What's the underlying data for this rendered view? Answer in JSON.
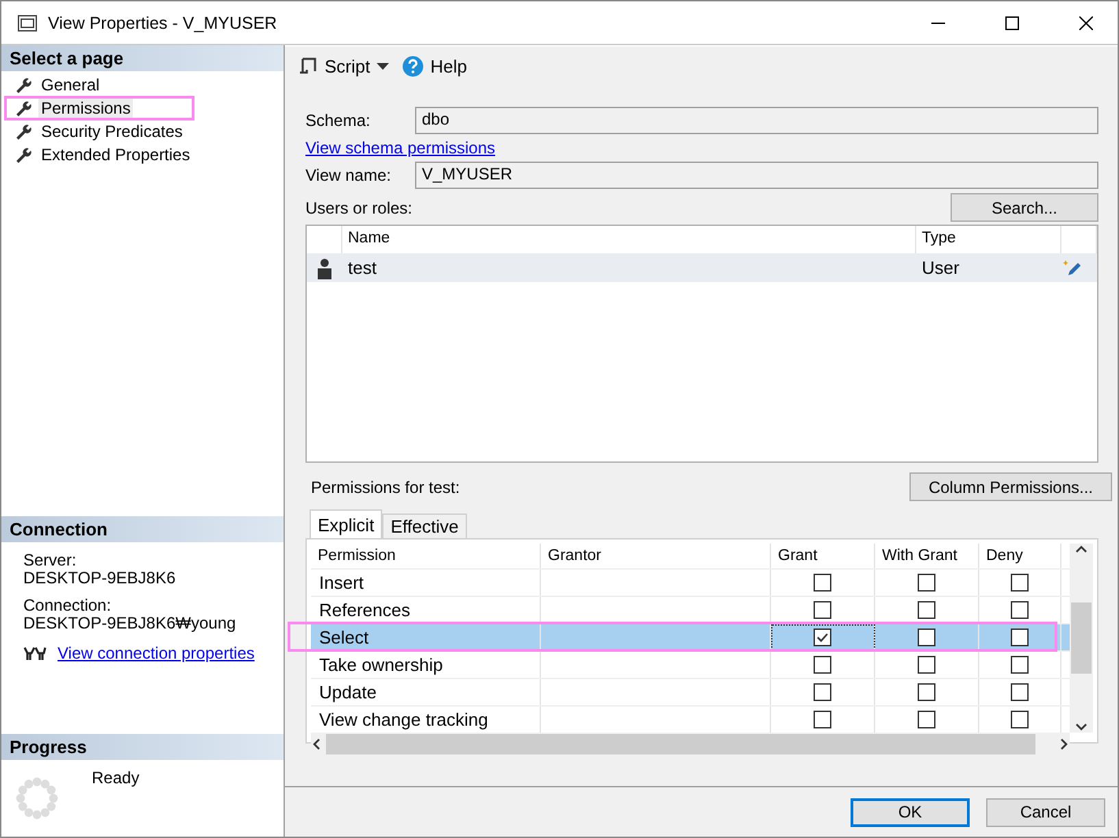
{
  "window": {
    "title": "View Properties - V_MYUSER"
  },
  "sidebar": {
    "heading": "Select a page",
    "items": [
      {
        "label": "General",
        "selected": false,
        "highlighted": false
      },
      {
        "label": "Permissions",
        "selected": true,
        "highlighted": true
      },
      {
        "label": "Security Predicates",
        "selected": false,
        "highlighted": false
      },
      {
        "label": "Extended Properties",
        "selected": false,
        "highlighted": false
      }
    ]
  },
  "connection": {
    "heading": "Connection",
    "server_label": "Server:",
    "server": "DESKTOP-9EBJ8K6",
    "connection_label": "Connection:",
    "connection": "DESKTOP-9EBJ8K6₩young",
    "link": "View connection properties"
  },
  "progress": {
    "heading": "Progress",
    "status": "Ready"
  },
  "toolbar": {
    "script": "Script",
    "help": "Help"
  },
  "schema": {
    "label": "Schema:",
    "value": "dbo",
    "link": "View schema permissions"
  },
  "view_name": {
    "label": "View name:",
    "value": "V_MYUSER"
  },
  "users": {
    "label": "Users or roles:",
    "search_button": "Search...",
    "columns": [
      "Name",
      "Type"
    ],
    "rows": [
      {
        "name": "test",
        "type": "User",
        "selected": true
      }
    ]
  },
  "permissions": {
    "label": "Permissions for test:",
    "column_button": "Column Permissions...",
    "tabs": [
      {
        "label": "Explicit",
        "selected": true
      },
      {
        "label": "Effective",
        "selected": false
      }
    ],
    "columns": [
      "Permission",
      "Grantor",
      "Grant",
      "With Grant",
      "Deny"
    ],
    "rows": [
      {
        "permission": "Insert",
        "grant": false,
        "with_grant": false,
        "deny": false,
        "selected": false,
        "highlighted": false
      },
      {
        "permission": "References",
        "grant": false,
        "with_grant": false,
        "deny": false,
        "selected": false,
        "highlighted": false
      },
      {
        "permission": "Select",
        "grant": true,
        "with_grant": false,
        "deny": false,
        "selected": true,
        "highlighted": true
      },
      {
        "permission": "Take ownership",
        "grant": false,
        "with_grant": false,
        "deny": false,
        "selected": false,
        "highlighted": false
      },
      {
        "permission": "Update",
        "grant": false,
        "with_grant": false,
        "deny": false,
        "selected": false,
        "highlighted": false
      },
      {
        "permission": "View change tracking",
        "grant": false,
        "with_grant": false,
        "deny": false,
        "selected": false,
        "highlighted": false
      }
    ]
  },
  "buttons": [
    {
      "label": "OK",
      "default": true
    },
    {
      "label": "Cancel",
      "default": false
    }
  ]
}
